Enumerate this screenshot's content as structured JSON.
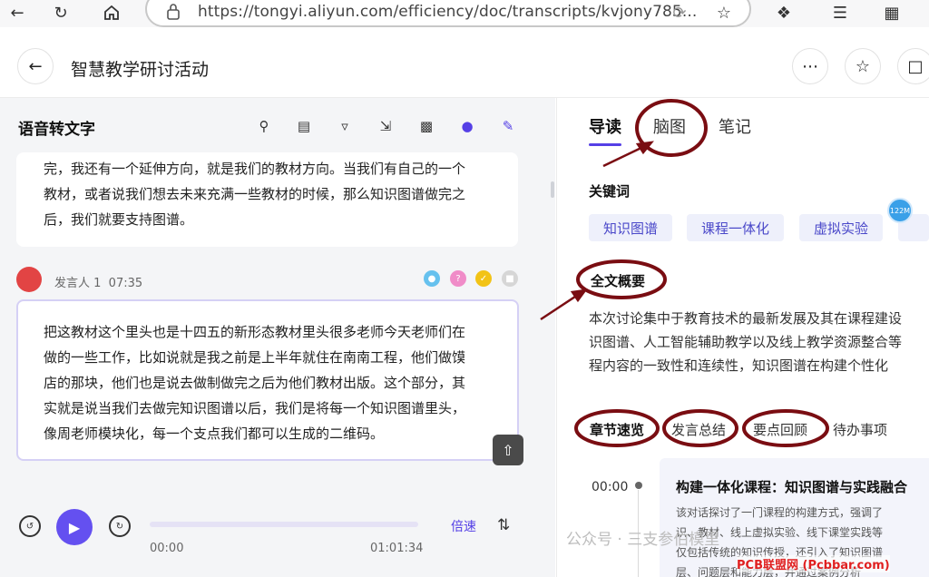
{
  "browser": {
    "url": "https://tongyi.aliyun.com/efficiency/doc/transcripts/kvjony785..."
  },
  "header": {
    "title": "智慧教学研讨活动"
  },
  "left": {
    "title": "语音转文字",
    "card1_lines": [
      "完，我还有一个延伸方向，就是我们的教材方向。当我们有自己的一个",
      "教材，或者说我们想去未来充满一些教材的时候，那么知识图谱做完之",
      "后，我们就要支持图谱。"
    ],
    "speaker": {
      "name": "发言人 1",
      "time": "07:35"
    },
    "card2_lines": [
      "把这教材这个里头也是十四五的新形态教材里头很多老师今天老师们在",
      "做的一些工作，比如说就是我之前是上半年就住在南南工程，他们做馍",
      "店的那块，他们也是说去做制做完之后为他们教材出版。这个部分，其",
      "实就是说当我们去做完知识图谱以后，我们是将每一个知识图谱里头，",
      "像周老师模块化，每一个支点我们都可以生成的二维码。"
    ],
    "player": {
      "current_time": "00:00",
      "total_time": "01:01:34",
      "speed_label": "倍速",
      "progress": 0
    }
  },
  "right": {
    "tabs": [
      "导读",
      "脑图",
      "笔记"
    ],
    "keywords_title": "关键词",
    "keywords": [
      "知识图谱",
      "课程一体化",
      "虚拟实验"
    ],
    "badge": "122M",
    "summary_title": "全文概要",
    "summary_lines": [
      "本次讨论集中于教育技术的最新发展及其在课程建设",
      "识图谱、人工智能辅助教学以及线上教学资源整合等",
      "程内容的一致性和连续性，知识图谱在构建个性化"
    ],
    "subtabs": [
      "章节速览",
      "发言总结",
      "要点回顾",
      "待办事项"
    ],
    "chapter": {
      "time": "00:00",
      "title": "构建一体化课程：知识图谱与实践融合",
      "body_lines": [
        "该对话探讨了一门课程的构建方式，强调了",
        "识、教材、线上虚拟实验、线下课堂实践等",
        "仅包括传统的知识传授，还引入了知识图谱",
        "层、问题层和能力层，并通过案例分析"
      ]
    }
  },
  "watermark": {
    "text": "公众号 · 三支参伯模里",
    "site": "PCB联盟网 (Pcbbar.com)"
  },
  "colors": {
    "accent": "#5540e6",
    "annotation": "#7a0d12"
  }
}
